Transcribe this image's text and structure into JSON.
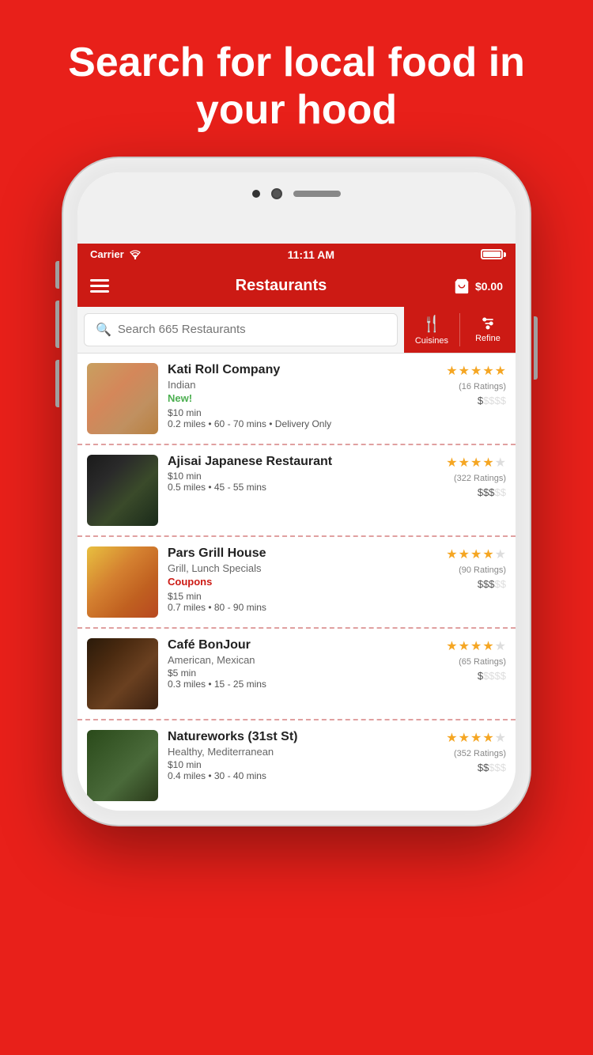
{
  "hero": {
    "title": "Search for local food in your hood"
  },
  "statusBar": {
    "carrier": "Carrier",
    "time": "11:11 AM"
  },
  "navBar": {
    "title": "Restaurants",
    "cartAmount": "$0.00"
  },
  "search": {
    "placeholder": "Search 665 Restaurants"
  },
  "filterButtons": [
    {
      "id": "cuisines",
      "label": "Cuisines",
      "icon": "🍴"
    },
    {
      "id": "refine",
      "label": "Refine",
      "icon": "🔧"
    }
  ],
  "restaurants": [
    {
      "id": 1,
      "name": "Kati Roll Company",
      "cuisine": "Indian",
      "badge": "New!",
      "badgeType": "new",
      "minOrder": "$10 min",
      "meta": "0.2 miles • 60 - 70 mins • Delivery Only",
      "stars": 5,
      "totalStars": 5,
      "ratingsCount": "(16 Ratings)",
      "priceActive": 1,
      "priceLevels": 5,
      "thumbClass": "food-1"
    },
    {
      "id": 2,
      "name": "Ajisai Japanese Restaurant",
      "cuisine": "",
      "badge": "",
      "badgeType": "",
      "minOrder": "$10 min",
      "meta": "0.5 miles • 45 - 55 mins",
      "stars": 4,
      "totalStars": 5,
      "ratingsCount": "(322 Ratings)",
      "priceActive": 3,
      "priceLevels": 5,
      "thumbClass": "food-2"
    },
    {
      "id": 3,
      "name": "Pars Grill House",
      "cuisine": "Grill, Lunch Specials",
      "badge": "Coupons",
      "badgeType": "coupon",
      "minOrder": "$15 min",
      "meta": "0.7 miles • 80 - 90 mins",
      "stars": 4,
      "totalStars": 5,
      "ratingsCount": "(90 Ratings)",
      "priceActive": 3,
      "priceLevels": 5,
      "thumbClass": "food-3"
    },
    {
      "id": 4,
      "name": "Café BonJour",
      "cuisine": "American, Mexican",
      "badge": "",
      "badgeType": "",
      "minOrder": "$5 min",
      "meta": "0.3 miles • 15 - 25 mins",
      "stars": 4,
      "totalStars": 5,
      "ratingsCount": "(65 Ratings)",
      "priceActive": 1,
      "priceLevels": 5,
      "thumbClass": "food-4"
    },
    {
      "id": 5,
      "name": "Natureworks (31st St)",
      "cuisine": "Healthy, Mediterranean",
      "badge": "",
      "badgeType": "",
      "minOrder": "$10 min",
      "meta": "0.4 miles • 30 - 40 mins",
      "stars": 4,
      "totalStars": 5,
      "ratingsCount": "(352 Ratings)",
      "priceActive": 2,
      "priceLevels": 5,
      "thumbClass": "food-5"
    }
  ]
}
